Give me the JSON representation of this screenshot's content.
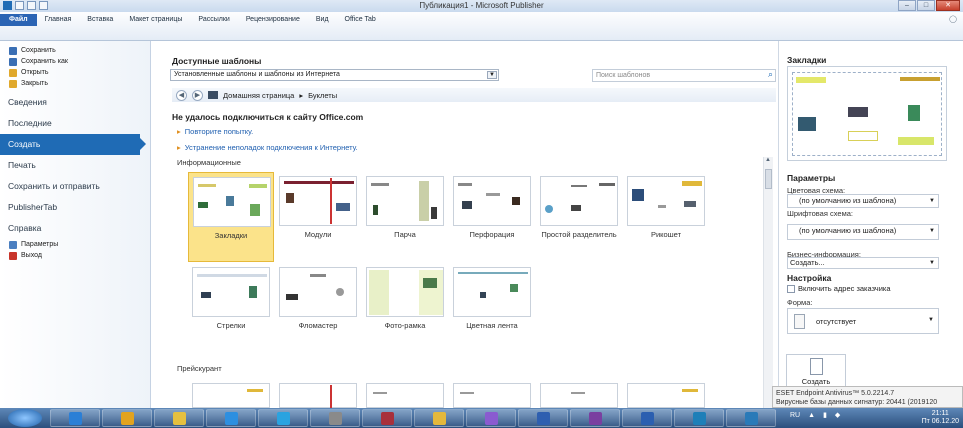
{
  "window": {
    "title": "Публикация1 - Microsoft Publisher",
    "controls": [
      "minimize",
      "maximize",
      "close"
    ]
  },
  "ribbon": {
    "tabs": [
      "Файл",
      "Главная",
      "Вставка",
      "Макет страницы",
      "Рассылки",
      "Рецензирование",
      "Вид",
      "Office Tab"
    ]
  },
  "backstage": {
    "commands": [
      {
        "label": "Сохранить",
        "icon": "save-icon",
        "color": "#3a6fb4"
      },
      {
        "label": "Сохранить как",
        "icon": "save-as-icon",
        "color": "#3a6fb4"
      },
      {
        "label": "Открыть",
        "icon": "open-folder-icon",
        "color": "#e0a92c"
      },
      {
        "label": "Закрыть",
        "icon": "close-folder-icon",
        "color": "#e0a92c"
      }
    ],
    "items": [
      "Сведения",
      "Последние",
      "Создать",
      "Печать",
      "Сохранить и отправить",
      "PublisherTab",
      "Справка"
    ],
    "active": "Создать",
    "bottom": [
      {
        "label": "Параметры",
        "icon": "options-icon",
        "color": "#4a7fc0"
      },
      {
        "label": "Выход",
        "icon": "exit-icon",
        "color": "#c8342a"
      }
    ]
  },
  "main": {
    "title": "Доступные шаблоны",
    "source_select": "Установленные шаблоны и шаблоны из Интернета",
    "search_placeholder": "Поиск шаблонов",
    "breadcrumb": [
      "Домашняя страница",
      "Буклеты"
    ],
    "error": "Не удалось подключиться к сайту Office.com",
    "links": [
      "Повторите попытку.",
      "Устранение неполадок подключения к Интернету."
    ],
    "group1": "Информационные",
    "templates_row1": [
      "Закладки",
      "Модули",
      "Парча",
      "Перфорация",
      "Простой разделитель",
      "Рикошет"
    ],
    "templates_row2": [
      "Стрелки",
      "Фломастер",
      "Фото-рамка",
      "Цветная лента"
    ],
    "group2": "Прейскурант",
    "selected": "Закладки"
  },
  "panel": {
    "title": "Закладки",
    "params_title": "Параметры",
    "color_label": "Цветовая схема:",
    "color_value": "(по умолчанию из шаблона)",
    "font_label": "Шрифтовая схема:",
    "font_value": "(по умолчанию из шаблона)",
    "biz_label": "Бизнес-информация:",
    "biz_value": "Создать...",
    "setup_title": "Настройка",
    "checkbox_label": "Включить адрес заказчика",
    "form_label": "Форма:",
    "form_value": "отсутствует",
    "create_label": "Создать"
  },
  "notification": {
    "line1": "ESET Endpoint Antivirus™ 5.0.2214.7",
    "line2": "Вирусные базы данных сигнатур: 20441 (2019120"
  },
  "taskbar": {
    "apps": [
      {
        "icon": "ie-icon",
        "color": "#2b7fd6"
      },
      {
        "icon": "chrome-icon",
        "color": "#e2a320"
      },
      {
        "icon": "explorer-icon",
        "color": "#e5c040"
      },
      {
        "icon": "media-player-icon",
        "color": "#2d8fe0"
      },
      {
        "icon": "telegram-icon",
        "color": "#2aa3e0"
      },
      {
        "icon": "tool-icon",
        "color": "#8a8a8a"
      },
      {
        "icon": "access-icon",
        "color": "#a8303b"
      },
      {
        "icon": "paint-icon",
        "color": "#e4b83c"
      },
      {
        "icon": "pen-icon",
        "color": "#8a5bd0"
      },
      {
        "icon": "save-app-icon",
        "color": "#2e5fb0"
      },
      {
        "icon": "onenote-icon",
        "color": "#7a3fa0"
      },
      {
        "icon": "word-icon",
        "color": "#2b5fb0"
      },
      {
        "icon": "publisher-icon",
        "color": "#1e7fb8"
      },
      {
        "icon": "publisher-doc-icon",
        "color": "#2a7ab8"
      }
    ],
    "lang": "RU",
    "time": "21:11",
    "date": "Пт 06.12.20"
  }
}
